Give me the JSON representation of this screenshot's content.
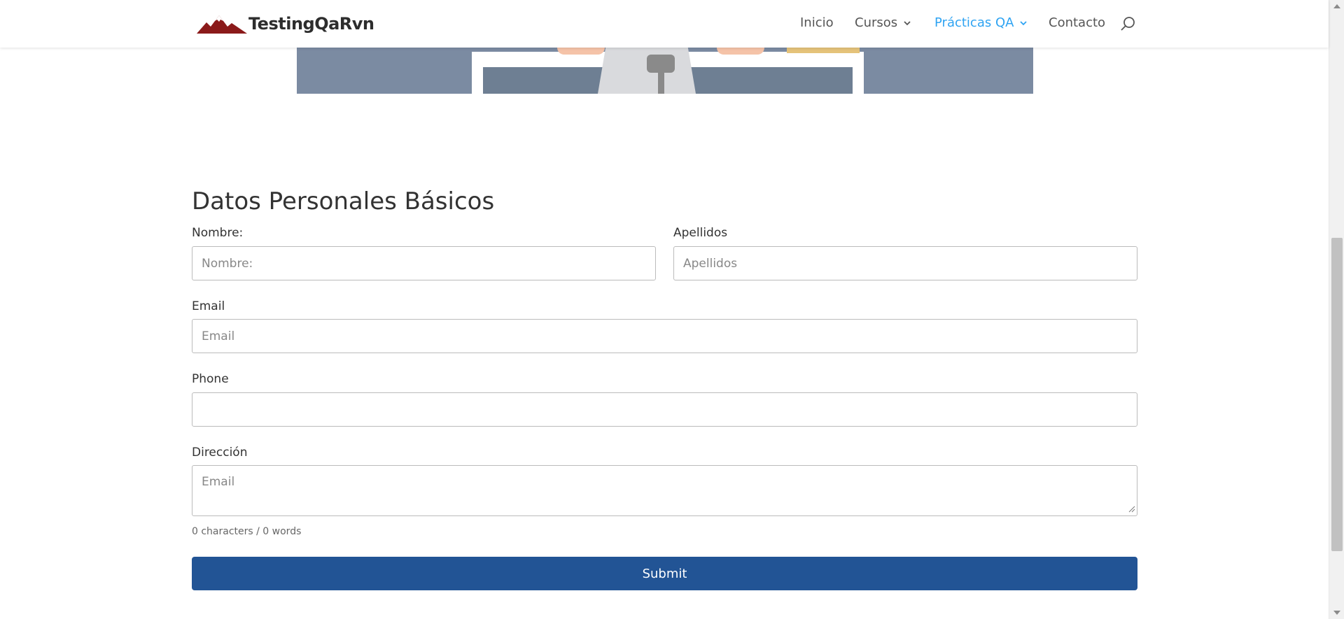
{
  "header": {
    "logo_text": "TestingQaRvn",
    "nav": [
      {
        "label": "Inicio",
        "has_dropdown": false,
        "active": false
      },
      {
        "label": "Cursos",
        "has_dropdown": true,
        "active": false
      },
      {
        "label": "Prácticas QA",
        "has_dropdown": true,
        "active": true
      },
      {
        "label": "Contacto",
        "has_dropdown": false,
        "active": false
      }
    ],
    "search_icon": "search-icon"
  },
  "form": {
    "title": "Datos Personales Básicos",
    "nombre": {
      "label": "Nombre:",
      "placeholder": "Nombre:",
      "value": ""
    },
    "apellidos": {
      "label": "Apellidos",
      "placeholder": "Apellidos",
      "value": ""
    },
    "email": {
      "label": "Email",
      "placeholder": "Email",
      "value": ""
    },
    "phone": {
      "label": "Phone",
      "placeholder": "",
      "value": ""
    },
    "direccion": {
      "label": "Dirección",
      "placeholder": "Email",
      "value": ""
    },
    "counter": "0 characters / 0 words",
    "submit_label": "Submit"
  },
  "colors": {
    "accent": "#2ea3f2",
    "submit_bg": "#225495",
    "hero_bg": "#7b8ba2"
  }
}
